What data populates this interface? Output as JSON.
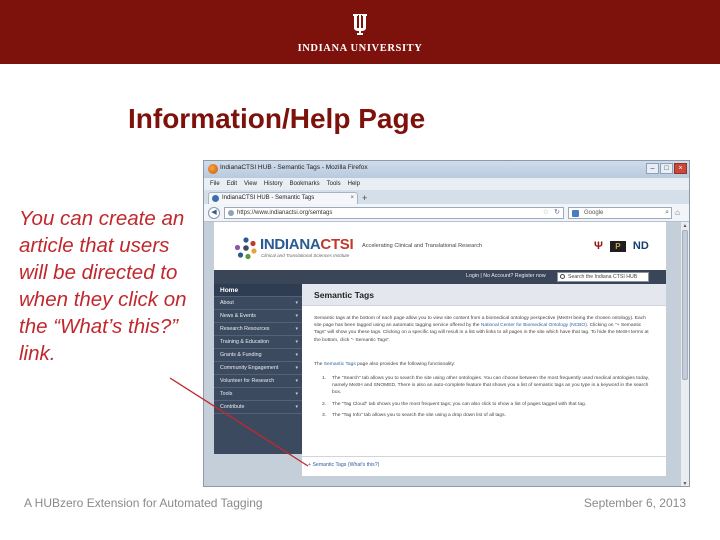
{
  "banner": {
    "university_name": "INDIANA UNIVERSITY",
    "logo_icon": "iu-trident-icon",
    "background_color": "#7d110c"
  },
  "slide": {
    "title": "Information/Help Page",
    "note": "You can create an article that users will be directed to when they click on the “What’s this?” link.",
    "footer_left": "A HUBzero Extension for Automated Tagging",
    "footer_right": "September 6, 2013",
    "title_color": "#7d110c",
    "note_color": "#c0282d"
  },
  "browser": {
    "window_title": "IndianaCTSI HUB - Semantic Tags - Mozilla Firefox",
    "menu": [
      "File",
      "Edit",
      "View",
      "History",
      "Bookmarks",
      "Tools",
      "Help"
    ],
    "tab_label": "IndianaCTSI HUB - Semantic Tags",
    "tab_close": "×",
    "new_tab": "+",
    "url": "https://www.indianactsi.org/semtags",
    "search_placeholder": "Google",
    "win_minimize": "–",
    "win_maximize": "□",
    "win_close": "×"
  },
  "site": {
    "logo_main": "INDIANA",
    "logo_accent": "CTSI",
    "logo_subtitle": "Clinical and Translational Sciences Institute",
    "header_tagline": "Accelerating Clinical and Translational Research",
    "partners": [
      "Ψ",
      "P",
      "ND"
    ],
    "login_links": "Login | No Account? Register now",
    "search_placeholder": "Search the Indiana CTSI HUB",
    "nav_home": "Home",
    "nav_items": [
      "About",
      "News & Events",
      "Research Resources",
      "Training & Education",
      "Grants & Funding",
      "Community Engagement",
      "Volunteer for Research",
      "Tools",
      "Contribute"
    ]
  },
  "content": {
    "title": "Semantic Tags",
    "intro_1": "Semantic tags at the bottom of each page allow you to view site content from a biomedical ontology perspective (MeSH being the chosen ontology). Each site page has been tagged using an automatic tagging service offered by the ",
    "intro_link": "National Center for Biomedical Ontology (NCBO)",
    "intro_2": ". Clicking on \"+ Semantic Tags\" will show you these tags. Clicking on a specific tag will result in a list with links to all pages in the site which have that tag. To hide the MeSH terms at the bottom, click \"- Semantic Tags\".",
    "lead_1": "The ",
    "lead_link": "Semantic Tags",
    "lead_2": " page also provides the following functionality:",
    "list": [
      "The \"Search\" tab allows you to search the site using other ontologies. You can choose between the most frequently used medical ontologies today, namely MeSH and SNOMED. There is also an auto-complete feature that shows you a list of semantic tags as you type in a keyword in the search box.",
      "The \"Tag Cloud\" tab shows you the most frequent tags; you can also click to show a list of pages tagged with that tag.",
      "The \"Tag Info\" tab allows you to search the site using a drop down list of all tags."
    ],
    "whats_this": "+ Semantic Tags (What's this?)"
  }
}
